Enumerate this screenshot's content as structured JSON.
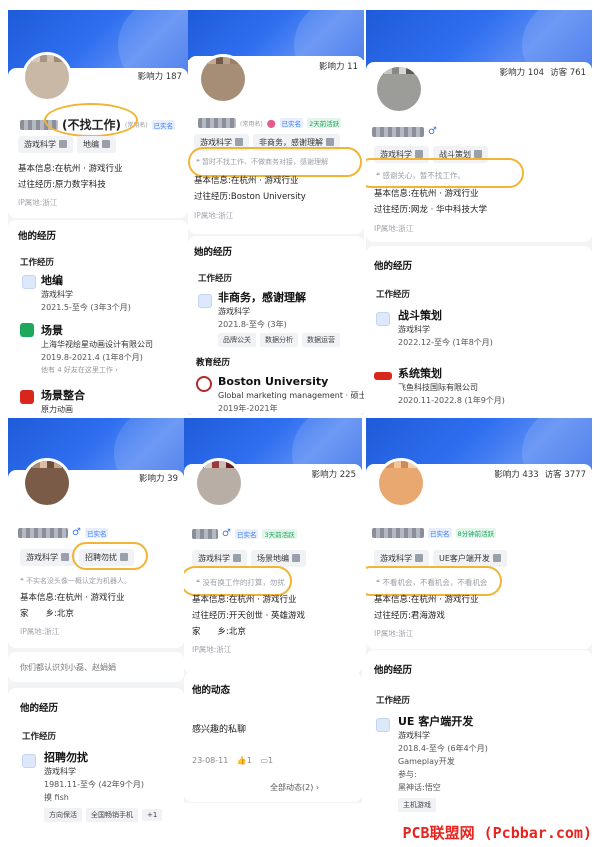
{
  "panels": [
    {
      "stats": {
        "influence": "影响力 187",
        "visitors": ""
      },
      "name_suffix": "(不找工作)",
      "name_note": "(常用名)",
      "verified": "已实名",
      "tags": [
        "游戏科学",
        "地编"
      ],
      "info": [
        "基本信息:在杭州 · 游戏行业",
        "过往经历:原力数字科技"
      ],
      "ip": "IP属地:浙江",
      "section": "他的经历",
      "sub": "工作经历",
      "jobs": [
        {
          "title": "地编",
          "company": "游戏科学",
          "date": "2021.5-至今 (3年3个月)"
        },
        {
          "title": "场景",
          "company": "上海华视绘星动画设计有限公司",
          "date": "2019.8-2021.4 (1年8个月)",
          "extra": "他有 4 好友在这里工作 ›"
        },
        {
          "title": "场景整合",
          "company": "原力动画"
        }
      ]
    },
    {
      "stats": {
        "influence": "影响力 11"
      },
      "name_note": "(常用名)",
      "verified": "已实名",
      "active": "2天前活跃",
      "tags": [
        "游戏科学",
        "非商务，感谢理解"
      ],
      "quote": "暂时不找工作、不做商务对接，感谢理解",
      "info": [
        "基本信息:在杭州 · 游戏行业",
        "过往经历:Boston University"
      ],
      "ip": "IP属地:浙江",
      "section": "她的经历",
      "sub": "工作经历",
      "job": {
        "title": "非商务，感谢理解",
        "company": "游戏科学",
        "date": "2021.8-至今 (3年)",
        "tags": [
          "品牌公关",
          "数据分析",
          "数据运营"
        ]
      },
      "edu_head": "教育经历",
      "edu": {
        "title": "Boston University",
        "major": "Global marketing management · 硕士",
        "date": "2019年-2021年"
      }
    },
    {
      "stats": {
        "influence": "影响力 104",
        "visitors": "访客 761"
      },
      "tags": [
        "游戏科学",
        "战斗策划"
      ],
      "quote": "感谢关心，暂不找工作。",
      "info": [
        "基本信息:在杭州 · 游戏行业",
        "过往经历:网龙 · 华中科技大学"
      ],
      "ip": "IP属地:浙江",
      "section": "他的经历",
      "sub": "工作经历",
      "jobs": [
        {
          "title": "战斗策划",
          "company": "游戏科学",
          "date": "2022.12-至今 (1年8个月)"
        },
        {
          "title": "系统策划",
          "company": "飞鱼科技国际有限公司",
          "date": "2020.11-2022.8 (1年9个月)"
        }
      ]
    },
    {
      "stats": {
        "influence": "影响力 39"
      },
      "verified": "已实名",
      "tags": [
        "游戏科学",
        "招聘勿扰"
      ],
      "quote": "不实名没头像一概认定为机器人。",
      "info": [
        "基本信息:在杭州 · 游戏行业",
        "家　　乡:北京"
      ],
      "ip": "IP属地:浙江",
      "mutual": "你们都认识刘小磊、赵娟娟",
      "section": "他的经历",
      "sub": "工作经历",
      "job": {
        "title": "招聘勿扰",
        "company": "游戏科学",
        "date": "1981.11-至今 (42年9个月)",
        "extra": "摸 fish",
        "tags": [
          "方向保活",
          "全国畅销手机",
          "+1"
        ]
      }
    },
    {
      "stats": {
        "influence": "影响力 225"
      },
      "verified": "已实名",
      "active": "3天前活跃",
      "tags": [
        "游戏科学",
        "场景地编"
      ],
      "quote": "没有换工作的打算，勿扰",
      "info": [
        "基本信息:在杭州 · 游戏行业",
        "过往经历:开天创世 · 英雄游戏",
        "家　　乡:北京"
      ],
      "ip": "IP属地:浙江",
      "section": "他的动态",
      "post": "感兴趣的私聊",
      "post_date": "23-08-11",
      "likes": "1",
      "comments": "1",
      "all": "全部动态(2) ›"
    },
    {
      "stats": {
        "influence": "影响力 433",
        "visitors": "访客 3777"
      },
      "verified": "已实名",
      "active": "8分钟前活跃",
      "tags": [
        "游戏科学",
        "UE客户端开发"
      ],
      "quote": "不看机会，不看机会，不看机会",
      "info": [
        "基本信息:在杭州 · 游戏行业",
        "过往经历:君海游戏"
      ],
      "ip": "IP属地:浙江",
      "section": "他的经历",
      "sub": "工作经历",
      "job": {
        "title": "UE 客户端开发",
        "company": "游戏科学",
        "date": "2018.4-至今 (6年4个月)",
        "lines": [
          "Gameplay开发",
          "参与:",
          "黑神话:悟空"
        ],
        "tags": [
          "主机游戏"
        ]
      }
    }
  ],
  "watermark": "PCB联盟网 (Pcbbar.com)",
  "colors": {
    "accent": "#2f6ff0",
    "circle": "#f2b434",
    "watermark": "#e8241f"
  }
}
